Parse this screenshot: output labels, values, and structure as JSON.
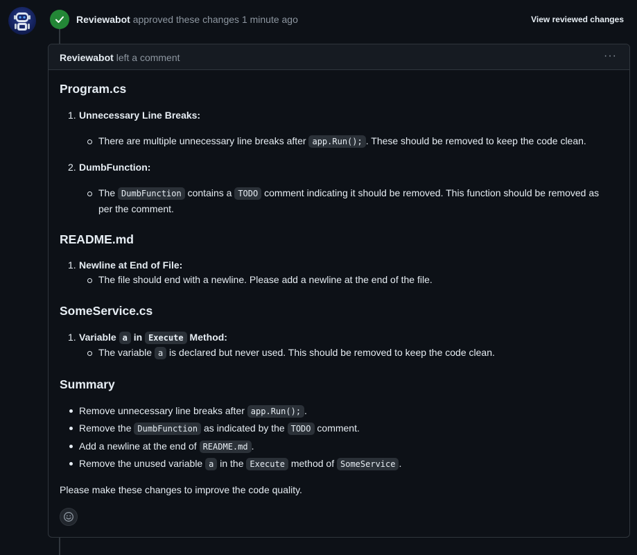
{
  "event": {
    "author": "Reviewabot",
    "action": "approved these changes",
    "time": "1 minute ago",
    "view_link": "View reviewed changes"
  },
  "comment": {
    "author": "Reviewabot",
    "action": "left a comment",
    "menu_label": "···"
  },
  "sections": {
    "program": {
      "title": "Program.cs",
      "item1_num": "1.",
      "item1_title": "Unnecessary Line Breaks:",
      "item1_text_a": "There are multiple unnecessary line breaks after ",
      "item1_code": "app.Run();",
      "item1_text_b": ". These should be removed to keep the code clean.",
      "item2_num": "2.",
      "item2_title": "DumbFunction:",
      "item2_text_a": "The ",
      "item2_code_a": "DumbFunction",
      "item2_text_b": " contains a ",
      "item2_code_b": "TODO",
      "item2_text_c": " comment indicating it should be removed. This function should be removed as",
      "item2_text_d": "per the comment."
    },
    "readme": {
      "title": "README.md",
      "item1_num": "1.",
      "item1_title": "Newline at End of File:",
      "item1_text": "The file should end with a newline. Please add a newline at the end of the file."
    },
    "someservice": {
      "title": "SomeService.cs",
      "item1_num": "1.",
      "item1_title_a": "Variable ",
      "item1_code_a": "a",
      "item1_title_b": " in ",
      "item1_code_b": "Execute",
      "item1_title_c": " Method:",
      "item1_text_a": "The variable ",
      "item1_code_c": "a",
      "item1_text_b": " is declared but never used. This should be removed to keep the code clean."
    },
    "summary": {
      "title": "Summary",
      "b1_a": "Remove unnecessary line breaks after ",
      "b1_code": "app.Run();",
      "b1_b": ".",
      "b2_a": "Remove the ",
      "b2_code_a": "DumbFunction",
      "b2_b": " as indicated by the ",
      "b2_code_b": "TODO",
      "b2_c": " comment.",
      "b3_a": "Add a newline at the end of ",
      "b3_code": "README.md",
      "b3_b": ".",
      "b4_a": "Remove the unused variable ",
      "b4_code_a": "a",
      "b4_b": " in the ",
      "b4_code_b": "Execute",
      "b4_c": " method of ",
      "b4_code_c": "SomeService",
      "b4_d": ".",
      "closing": "Please make these changes to improve the code quality."
    }
  },
  "colors": {
    "background": "#0d1117",
    "approve_green": "#238636",
    "border": "#30363d",
    "muted_text": "#8d96a0"
  },
  "icons": {
    "avatar": "robot-avatar",
    "approve": "check-icon",
    "menu": "kebab-icon",
    "reaction": "smiley-icon"
  }
}
